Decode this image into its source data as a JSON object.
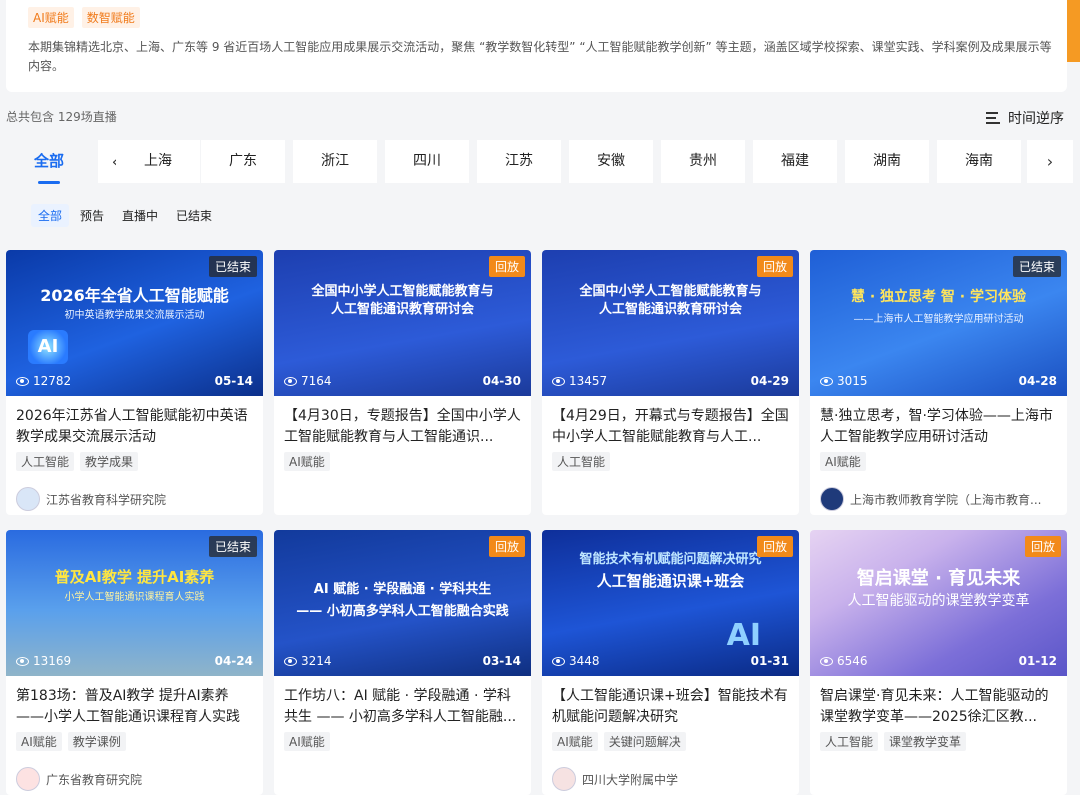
{
  "header": {
    "tags": [
      "AI赋能",
      "数智赋能"
    ],
    "description": "本期集锦精选北京、上海、广东等 9 省近百场人工智能应用成果展示交流活动，聚焦 “教学数智化转型” “人工智能赋能教学创新” 等主题，涵盖区域学校探索、课堂实践、学科案例及成果展示等内容。"
  },
  "summary": {
    "total": "总共包含 129场直播",
    "sort_label": "时间逆序"
  },
  "regions": {
    "all": "全部",
    "items": [
      "上海",
      "广东",
      "浙江",
      "四川",
      "江苏",
      "安徽",
      "贵州",
      "福建",
      "湖南",
      "海南"
    ]
  },
  "status_filters": [
    "全部",
    "预告",
    "直播中",
    "已结束"
  ],
  "cards": [
    {
      "badge": "已结束",
      "views": "12782",
      "date": "05-14",
      "thumb_title": "2026年全省人工智能赋能",
      "thumb_sub": "初中英语教学成果交流展示活动",
      "title": "2026年江苏省人工智能赋能初中英语教学成果交流展示活动",
      "tags": [
        "人工智能",
        "教学成果"
      ],
      "org": "江苏省教育科学研究院"
    },
    {
      "badge": "回放",
      "views": "7164",
      "date": "04-30",
      "thumb_title": "全国中小学人工智能赋能教育与",
      "thumb_sub": "人工智能通识教育研讨会",
      "title": "【4月30日，专题报告】全国中小学人工智能赋能教育与人工智能通识...",
      "tags": [
        "AI赋能"
      ],
      "org": ""
    },
    {
      "badge": "回放",
      "views": "13457",
      "date": "04-29",
      "thumb_title": "全国中小学人工智能赋能教育与",
      "thumb_sub": "人工智能通识教育研讨会",
      "title": "【4月29日，开幕式与专题报告】全国中小学人工智能赋能教育与人工...",
      "tags": [
        "人工智能"
      ],
      "org": ""
    },
    {
      "badge": "已结束",
      "views": "3015",
      "date": "04-28",
      "thumb_title": "慧 · 独立思考  智 · 学习体验",
      "thumb_sub": "——上海市人工智能教学应用研讨活动",
      "title": "慧·独立思考，智·学习体验——上海市人工智能教学应用研讨活动",
      "tags": [
        "AI赋能"
      ],
      "org": "上海市教师教育学院（上海市教育..."
    },
    {
      "badge": "已结束",
      "views": "13169",
      "date": "04-24",
      "thumb_title": "普及AI教学  提升AI素养",
      "thumb_sub": "小学人工智能通识课程育人实践",
      "title": "第183场：普及AI教学 提升AI素养——小学人工智能通识课程育人实践",
      "tags": [
        "AI赋能",
        "教学课例"
      ],
      "org": "广东省教育研究院"
    },
    {
      "badge": "回放",
      "views": "3214",
      "date": "03-14",
      "thumb_title": "AI 赋能 · 学段融通 · 学科共生",
      "thumb_sub": "—— 小初高多学科人工智能融合实践",
      "title": "工作坊八：AI 赋能 · 学段融通 · 学科共生 —— 小初高多学科人工智能融...",
      "tags": [
        "AI赋能"
      ],
      "org": ""
    },
    {
      "badge": "回放",
      "views": "3448",
      "date": "01-31",
      "thumb_title": "智能技术有机赋能问题解决研究",
      "thumb_sub": "人工智能通识课+班会",
      "title": "【人工智能通识课+班会】智能技术有机赋能问题解决研究",
      "tags": [
        "AI赋能",
        "关键问题解决"
      ],
      "org": "四川大学附属中学"
    },
    {
      "badge": "回放",
      "views": "6546",
      "date": "01-12",
      "thumb_title": "智启课堂 · 育见未来",
      "thumb_sub": "人工智能驱动的课堂教学变革",
      "title": "智启课堂·育见未来：人工智能驱动的课堂教学变革——2025徐汇区教...",
      "tags": [
        "人工智能",
        "课堂教学变革"
      ],
      "org": ""
    }
  ],
  "colors": {
    "accent": "#1a6cf0",
    "replay": "#f28a1a",
    "tag_orange": "#f07a1a"
  }
}
